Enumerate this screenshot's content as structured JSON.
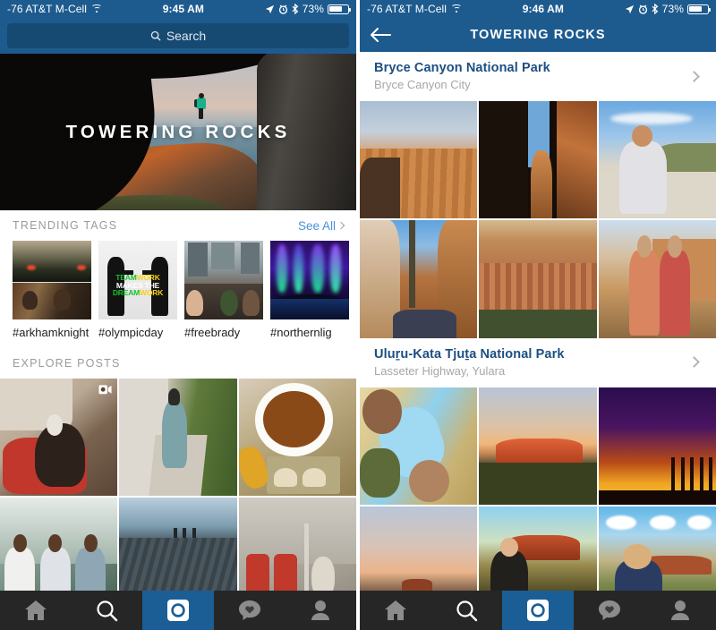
{
  "left": {
    "status_bar": {
      "carrier": "-76 AT&T M-Cell",
      "wifi_icon": "wifi-icon",
      "time": "9:45 AM",
      "location_icon": "location-arrow-icon",
      "alarm_icon": "alarm-clock-icon",
      "bluetooth_icon": "bluetooth-icon",
      "battery_percent": "73%",
      "battery_icon": "battery-icon"
    },
    "search": {
      "placeholder": "Search",
      "icon": "search-icon"
    },
    "hero": {
      "title": "TOWERING ROCKS"
    },
    "trending": {
      "header": "TRENDING TAGS",
      "see_all": "See All",
      "see_all_icon": "chevron-right-icon",
      "tags": [
        {
          "label": "#arkhamknight",
          "art": "arkhamknight"
        },
        {
          "label": "#olympicday",
          "art": "olympicday",
          "art_text": {
            "line1a": "TEAM",
            "line1b": "WORK",
            "line2": "MAKES THE",
            "line3a": "DREAM",
            "line3b": "WORK"
          }
        },
        {
          "label": "#freebrady",
          "art": "freebrady"
        },
        {
          "label": "#northernlig",
          "art": "northernlights"
        }
      ]
    },
    "explore": {
      "header": "EXPLORE POSTS",
      "posts": [
        {
          "art": "e1",
          "badge": "video-icon"
        },
        {
          "art": "e2",
          "badge": null
        },
        {
          "art": "e3",
          "badge": null
        },
        {
          "art": "e4",
          "badge": null
        },
        {
          "art": "e5",
          "badge": null
        },
        {
          "art": "e6",
          "badge": null
        }
      ]
    }
  },
  "right": {
    "status_bar": {
      "carrier": "-76 AT&T M-Cell",
      "wifi_icon": "wifi-icon",
      "time": "9:46 AM",
      "location_icon": "location-arrow-icon",
      "alarm_icon": "alarm-clock-icon",
      "bluetooth_icon": "bluetooth-icon",
      "battery_percent": "73%",
      "battery_icon": "battery-icon"
    },
    "nav": {
      "back_icon": "back-arrow-icon",
      "title": "TOWERING ROCKS"
    },
    "places": [
      {
        "title": "Bryce Canyon National Park",
        "subtitle": "Bryce Canyon City",
        "chevron_icon": "chevron-right-icon",
        "photos": [
          "b1a",
          "b2a",
          "b3a",
          "b4a",
          "b5a",
          "b6a"
        ]
      },
      {
        "title": "Uluṟu-Kata Tjuṯa National Park",
        "subtitle": "Lasseter Highway, Yulara",
        "chevron_icon": "chevron-right-icon",
        "photos": [
          "u1a",
          "u2a",
          "u3a",
          "u4a",
          "u5a",
          "u6a"
        ]
      }
    ]
  },
  "tabbar": {
    "tabs": [
      {
        "name": "home-tab",
        "icon": "home-icon",
        "state": "inactive"
      },
      {
        "name": "search-tab",
        "icon": "search-icon",
        "state": "selected"
      },
      {
        "name": "camera-tab",
        "icon": "camera-icon",
        "state": "highlighted"
      },
      {
        "name": "activity-tab",
        "icon": "heart-bubble-icon",
        "state": "inactive"
      },
      {
        "name": "profile-tab",
        "icon": "person-icon",
        "state": "inactive"
      }
    ]
  },
  "colors": {
    "nav_blue": "#1d5b8f",
    "search_field": "#174a72",
    "link_blue": "#4a90d9",
    "place_title": "#1c4f82",
    "tabbar_bg": "#262626",
    "tab_highlight": "#1b5e96",
    "section_header": "#9b9b9b"
  }
}
